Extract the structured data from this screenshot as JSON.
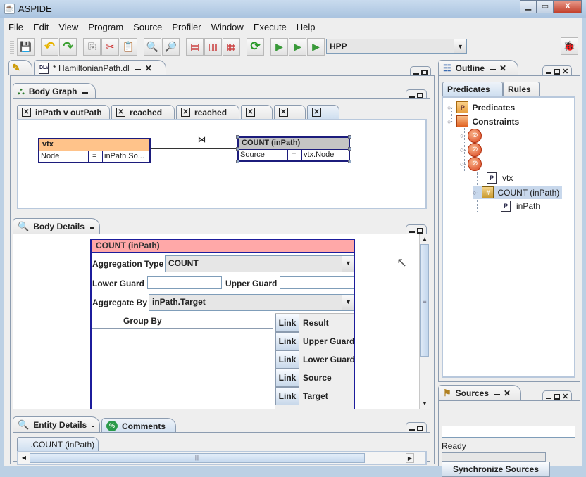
{
  "window": {
    "title": "ASPIDE",
    "controls": {
      "minimize": "—",
      "maximize": "□",
      "close": "X"
    }
  },
  "menu": [
    "File",
    "Edit",
    "View",
    "Program",
    "Source",
    "Profiler",
    "Window",
    "Execute",
    "Help"
  ],
  "toolbar": {
    "buttons": [
      {
        "name": "save",
        "icon": "floppy-disk-icon",
        "glyph": "💾"
      },
      {
        "name": "undo",
        "icon": "undo-arrow-icon",
        "glyph": "↶"
      },
      {
        "name": "redo",
        "icon": "redo-arrow-icon",
        "glyph": "↷"
      },
      {
        "name": "copy",
        "icon": "copy-icon",
        "glyph": "⎘"
      },
      {
        "name": "cut",
        "icon": "scissors-icon",
        "glyph": "✂"
      },
      {
        "name": "paste",
        "icon": "clipboard-icon",
        "glyph": "📋"
      },
      {
        "name": "find",
        "icon": "magnifier-icon",
        "glyph": "🔍"
      },
      {
        "name": "find-replace",
        "icon": "magnifier-arrow-icon",
        "glyph": "🔎"
      },
      {
        "name": "add-rule",
        "icon": "rule-icon",
        "glyph": "▤"
      },
      {
        "name": "add-rules",
        "icon": "rules-icon",
        "glyph": "▥"
      },
      {
        "name": "add-constraints",
        "icon": "constraints-icon",
        "glyph": "▦"
      },
      {
        "name": "refresh",
        "icon": "refresh-icon",
        "glyph": "⟳"
      },
      {
        "name": "run-config",
        "icon": "run-config-icon",
        "glyph": "▶"
      },
      {
        "name": "run-debug",
        "icon": "run-debug-icon",
        "glyph": "▶"
      },
      {
        "name": "run",
        "icon": "run-icon",
        "glyph": "▶"
      }
    ],
    "run_config": {
      "value": "HPP"
    },
    "debug_button": {
      "icon": "bug-icon",
      "glyph": "🐞"
    }
  },
  "editor": {
    "side_tab_icon": "pencil-icon",
    "file_tab": {
      "label": "* HamiltonianPath.dl",
      "icon": "dlv-file-icon"
    },
    "body_graph": {
      "title": "Body Graph",
      "subtabs": [
        {
          "label": "inPath v outPath"
        },
        {
          "label": "reached"
        },
        {
          "label": "reached"
        },
        {
          "label": ""
        },
        {
          "label": ""
        },
        {
          "label": "",
          "selected": true
        }
      ],
      "nodes": [
        {
          "title": "vtx",
          "row": [
            "Node",
            "=",
            "inPath.So..."
          ],
          "color": "#ffc38a"
        },
        {
          "title": "COUNT (inPath)",
          "row": [
            "Source",
            "=",
            "vtx.Node"
          ],
          "color": "#c4c4c4"
        }
      ],
      "join_symbol": "⋈"
    },
    "body_details": {
      "title": "Body Details",
      "header": "COUNT (inPath)",
      "header_color": "#ffa8a8",
      "aggregation_type_label": "Aggregation Type",
      "aggregation_type_value": "COUNT",
      "lower_guard_label": "Lower Guard",
      "lower_guard_value": "",
      "upper_guard_label": "Upper Guard",
      "upper_guard_value": "",
      "aggregate_by_label": "Aggregate By",
      "aggregate_by_value": "inPath.Target",
      "group_by_label": "Group By",
      "link_button_label": "Link",
      "links": [
        "Result",
        "Upper Guard",
        "Lower Guard",
        "Source",
        "Target"
      ]
    },
    "entity_details": {
      "title": "Entity Details",
      "comments_tab": "Comments",
      "subtab": ".COUNT (inPath)"
    }
  },
  "outline": {
    "title": "Outline",
    "tabs": [
      {
        "label": "Predicates",
        "selected": true
      },
      {
        "label": "Rules"
      }
    ],
    "tree": [
      {
        "label": "Predicates",
        "icon": "predicates-folder-icon",
        "level": 0
      },
      {
        "label": "Constraints",
        "icon": "constraints-folder-icon",
        "level": 0
      },
      {
        "label": "",
        "icon": "constraint-icon",
        "level": 1
      },
      {
        "label": "",
        "icon": "constraint-icon",
        "level": 1
      },
      {
        "label": "",
        "icon": "constraint-icon",
        "level": 1
      },
      {
        "label": "vtx",
        "icon": "predicate-page-icon",
        "level": 2
      },
      {
        "label": "COUNT (inPath)",
        "icon": "aggregate-box-icon",
        "level": 2,
        "selected": true
      },
      {
        "label": "inPath",
        "icon": "predicate-page-icon",
        "level": 3
      }
    ]
  },
  "sources": {
    "title": "Sources",
    "input_value": "",
    "status": "Ready",
    "progress": 0,
    "sync_button": "Synchronize Sources"
  }
}
